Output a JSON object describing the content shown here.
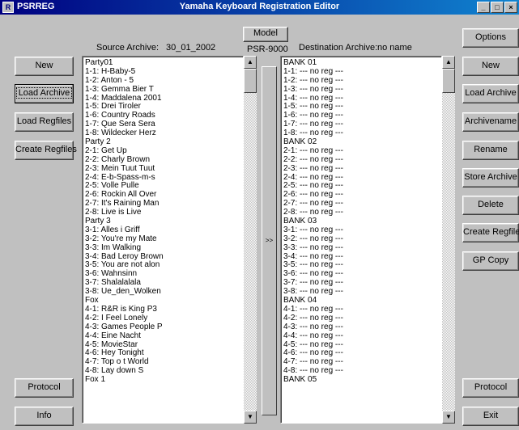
{
  "window": {
    "app_name": "PSRREG",
    "title": "Yamaha Keyboard Registration Editor",
    "controls": {
      "minimize": "_",
      "maximize": "□",
      "close": "×"
    }
  },
  "header": {
    "model_button": "Model",
    "model_value": "PSR-9000",
    "source_label": "Source Archive:",
    "source_value": "30_01_2002",
    "destination_label": "Destination Archive:",
    "destination_value": "no name"
  },
  "left_buttons": {
    "new": "New",
    "load_archive": "Load Archive",
    "load_regfiles": "Load Regfiles",
    "create_regfiles": "Create Regfiles",
    "protocol": "Protocol",
    "info": "Info"
  },
  "right_buttons": {
    "options": "Options",
    "new": "New",
    "load_archive": "Load Archive",
    "archivename": "Archivename",
    "rename": "Rename",
    "store_archive": "Store Archive",
    "delete": "Delete",
    "create_regfiles": "Create Regfiles",
    "gp_copy": "GP Copy",
    "protocol": "Protocol",
    "exit": "Exit"
  },
  "transfer_button": ">>",
  "scroll_glyphs": {
    "up": "▲",
    "down": "▼"
  },
  "source_list": [
    "Party01",
    "1-1: H-Baby-5",
    "1-2: Anton - 5",
    "1-3: Gemma Bier T",
    "1-4: Maddalena 2001",
    "1-5: Drei Tiroler",
    "1-6: Country Roads",
    "1-7: Que Sera Sera",
    "1-8: Wildecker Herz",
    "Party 2",
    "2-1: Get Up",
    "2-2: Charly Brown",
    "2-3: Mein Tuut Tuut",
    "2-4: E-b-Spass-m-s",
    "2-5: Volle Pulle",
    "2-6: Rockin All Over",
    "2-7: It's Raining Man",
    "2-8: Live is Live",
    "Party 3",
    "3-1: Alles i Griff",
    "3-2: You're my Mate",
    "3-3: Im Walking",
    "3-4: Bad Leroy Brown",
    "3-5: You are not alon",
    "3-6: Wahnsinn",
    "3-7: Shalalalala",
    "3-8: Ue_den_Wolken",
    "Fox",
    "4-1: R&R is King P3",
    "4-2: I Feel Lonely",
    "4-3: Games People P",
    "4-4: Eine Nacht",
    "4-5: MovieStar",
    "4-6: Hey Tonight",
    "4-7: Top o t World",
    "4-8: Lay down S",
    "Fox 1"
  ],
  "destination_list": [
    "BANK 01",
    "1-1: --- no reg ---",
    "1-2: --- no reg ---",
    "1-3: --- no reg ---",
    "1-4: --- no reg ---",
    "1-5: --- no reg ---",
    "1-6: --- no reg ---",
    "1-7: --- no reg ---",
    "1-8: --- no reg ---",
    "BANK 02",
    "2-1: --- no reg ---",
    "2-2: --- no reg ---",
    "2-3: --- no reg ---",
    "2-4: --- no reg ---",
    "2-5: --- no reg ---",
    "2-6: --- no reg ---",
    "2-7: --- no reg ---",
    "2-8: --- no reg ---",
    "BANK 03",
    "3-1: --- no reg ---",
    "3-2: --- no reg ---",
    "3-3: --- no reg ---",
    "3-4: --- no reg ---",
    "3-5: --- no reg ---",
    "3-6: --- no reg ---",
    "3-7: --- no reg ---",
    "3-8: --- no reg ---",
    "BANK 04",
    "4-1: --- no reg ---",
    "4-2: --- no reg ---",
    "4-3: --- no reg ---",
    "4-4: --- no reg ---",
    "4-5: --- no reg ---",
    "4-6: --- no reg ---",
    "4-7: --- no reg ---",
    "4-8: --- no reg ---",
    "BANK 05"
  ]
}
